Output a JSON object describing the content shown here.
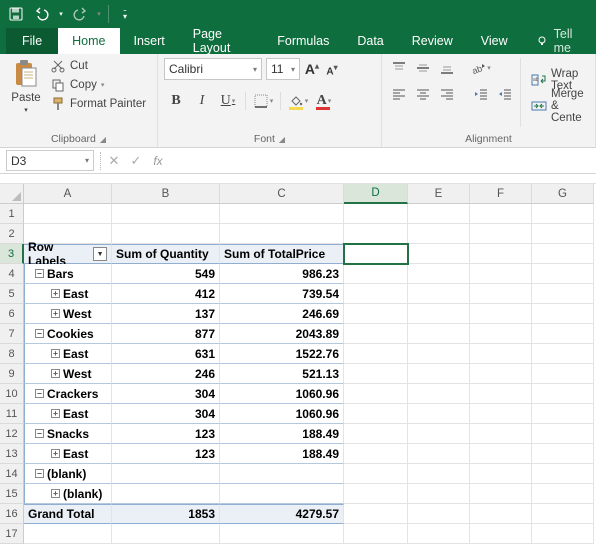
{
  "quickAccess": {
    "save": "save-icon",
    "undo": "undo-icon",
    "redo": "redo-icon"
  },
  "menu": {
    "file": "File",
    "home": "Home",
    "insert": "Insert",
    "pageLayout": "Page Layout",
    "formulas": "Formulas",
    "data": "Data",
    "review": "Review",
    "view": "View",
    "tellMe": "Tell me"
  },
  "ribbon": {
    "clipboard": {
      "paste": "Paste",
      "cut": "Cut",
      "copy": "Copy",
      "formatPainter": "Format Painter",
      "groupLabel": "Clipboard"
    },
    "font": {
      "name": "Calibri",
      "size": "11",
      "groupLabel": "Font"
    },
    "alignment": {
      "wrapText": "Wrap Text",
      "mergeCenter": "Merge & Cente",
      "groupLabel": "Alignment"
    }
  },
  "formulaBar": {
    "nameBox": "D3",
    "fxLabel": "fx",
    "formula": ""
  },
  "columns": [
    "A",
    "B",
    "C",
    "D",
    "E",
    "F",
    "G"
  ],
  "activeColumn": "D",
  "activeRow": 3,
  "pivot": {
    "headers": {
      "rowLabels": "Row Labels",
      "sumQty": "Sum of Quantity",
      "sumPrice": "Sum of TotalPrice"
    },
    "rows": [
      {
        "label": "Bars",
        "indent": 1,
        "exp": "-",
        "qty": "549",
        "price": "986.23",
        "bold": true
      },
      {
        "label": "East",
        "indent": 2,
        "exp": "+",
        "qty": "412",
        "price": "739.54",
        "bold": true
      },
      {
        "label": "West",
        "indent": 2,
        "exp": "+",
        "qty": "137",
        "price": "246.69",
        "bold": true
      },
      {
        "label": "Cookies",
        "indent": 1,
        "exp": "-",
        "qty": "877",
        "price": "2043.89",
        "bold": true
      },
      {
        "label": "East",
        "indent": 2,
        "exp": "+",
        "qty": "631",
        "price": "1522.76",
        "bold": true
      },
      {
        "label": "West",
        "indent": 2,
        "exp": "+",
        "qty": "246",
        "price": "521.13",
        "bold": true
      },
      {
        "label": "Crackers",
        "indent": 1,
        "exp": "-",
        "qty": "304",
        "price": "1060.96",
        "bold": true
      },
      {
        "label": "East",
        "indent": 2,
        "exp": "+",
        "qty": "304",
        "price": "1060.96",
        "bold": true
      },
      {
        "label": "Snacks",
        "indent": 1,
        "exp": "-",
        "qty": "123",
        "price": "188.49",
        "bold": true
      },
      {
        "label": "East",
        "indent": 2,
        "exp": "+",
        "qty": "123",
        "price": "188.49",
        "bold": true
      },
      {
        "label": "(blank)",
        "indent": 1,
        "exp": "-",
        "qty": "",
        "price": "",
        "bold": true
      },
      {
        "label": "(blank)",
        "indent": 2,
        "exp": "+",
        "qty": "",
        "price": "",
        "bold": true
      }
    ],
    "grandTotal": {
      "label": "Grand Total",
      "qty": "1853",
      "price": "4279.57"
    }
  }
}
